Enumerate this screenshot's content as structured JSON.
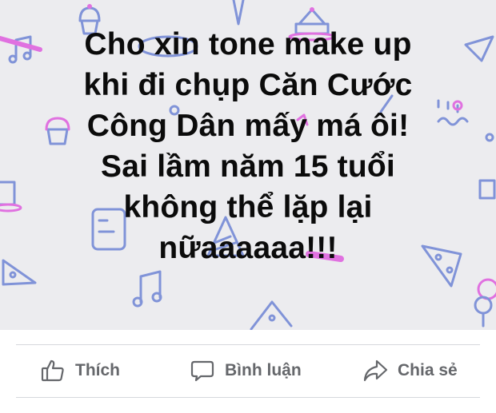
{
  "post": {
    "background_color": "#ececef",
    "text_lines": [
      "Cho xin tone make up",
      "khi đi chụp Căn Cước",
      "Công Dân mấy má ôi!",
      "Sai lầm năm 15 tuổi",
      "không thể lặp lại",
      "nữaaaaaa!!!"
    ],
    "background_doodles": [
      "cupcake-icon",
      "cake-icon",
      "pizza-icon",
      "music-note-icon",
      "party-hat-icon",
      "balloon-icon",
      "pennant-icon"
    ]
  },
  "actions": {
    "like": {
      "label": "Thích",
      "icon": "thumbs-up-icon"
    },
    "comment": {
      "label": "Bình luận",
      "icon": "comment-icon"
    },
    "share": {
      "label": "Chia sẻ",
      "icon": "share-icon"
    }
  },
  "colors": {
    "action_text": "#65676b",
    "doodle_blue": "#7b8fd6",
    "doodle_pink": "#e071e0"
  }
}
